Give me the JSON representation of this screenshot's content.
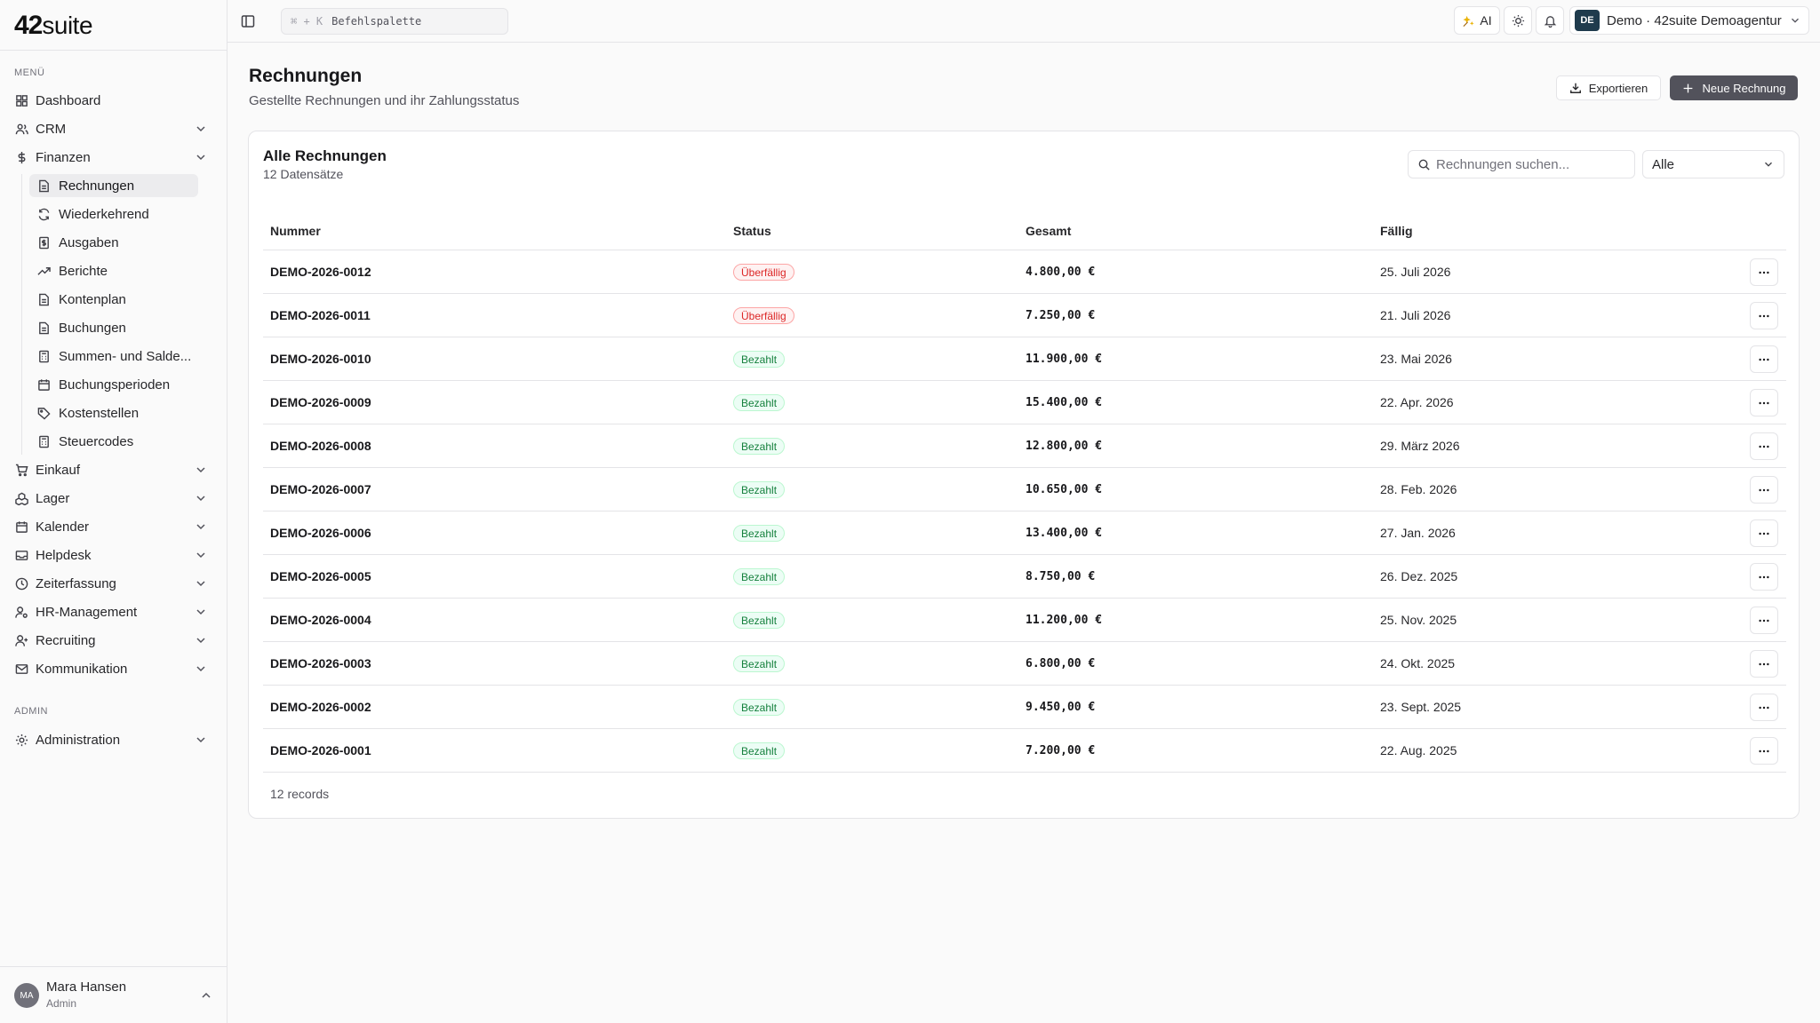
{
  "brand": {
    "logo_num": "42",
    "logo_suite": "suite"
  },
  "sidebar": {
    "menu_label": "MENÜ",
    "admin_label": "ADMIN",
    "items": [
      {
        "label": "Dashboard",
        "icon": "grid-icon"
      },
      {
        "label": "CRM",
        "icon": "users-icon"
      },
      {
        "label": "Finanzen",
        "icon": "dollar-icon"
      },
      {
        "label": "Einkauf",
        "icon": "cart-icon"
      },
      {
        "label": "Lager",
        "icon": "boxes-icon"
      },
      {
        "label": "Kalender",
        "icon": "calendar-icon"
      },
      {
        "label": "Helpdesk",
        "icon": "inbox-icon"
      },
      {
        "label": "Zeiterfassung",
        "icon": "clock-icon"
      },
      {
        "label": "HR-Management",
        "icon": "user-cog-icon"
      },
      {
        "label": "Recruiting",
        "icon": "user-plus-icon"
      },
      {
        "label": "Kommunikation",
        "icon": "mail-icon"
      }
    ],
    "finance_sub": [
      {
        "label": "Rechnungen",
        "icon": "file-text-icon"
      },
      {
        "label": "Wiederkehrend",
        "icon": "refresh-icon"
      },
      {
        "label": "Ausgaben",
        "icon": "receipt-icon"
      },
      {
        "label": "Berichte",
        "icon": "trending-up-icon"
      },
      {
        "label": "Kontenplan",
        "icon": "file-icon"
      },
      {
        "label": "Buchungen",
        "icon": "file-icon"
      },
      {
        "label": "Summen- und Salde...",
        "icon": "calculator-icon"
      },
      {
        "label": "Buchungsperioden",
        "icon": "calendar-icon"
      },
      {
        "label": "Kostenstellen",
        "icon": "tag-icon"
      },
      {
        "label": "Steuercodes",
        "icon": "calculator-icon"
      }
    ],
    "admin_item": {
      "label": "Administration",
      "icon": "settings-icon"
    },
    "user": {
      "initials": "MA",
      "name": "Mara Hansen",
      "role": "Admin"
    }
  },
  "topbar": {
    "cmd_kbd": "⌘ + K",
    "cmd_label": "Befehlspalette",
    "ai_label": "AI",
    "org_badge": "DE",
    "org_label": "Demo · 42suite Demoagentur"
  },
  "page": {
    "title": "Rechnungen",
    "subtitle": "Gestellte Rechnungen und ihr Zahlungsstatus",
    "export_label": "Exportieren",
    "new_label": "Neue Rechnung"
  },
  "card": {
    "title": "Alle Rechnungen",
    "subtitle": "12 Datensätze",
    "search_placeholder": "Rechnungen suchen...",
    "filter_value": "Alle",
    "footer": "12 records"
  },
  "table": {
    "headers": {
      "number": "Nummer",
      "status": "Status",
      "total": "Gesamt",
      "due": "Fällig"
    },
    "rows": [
      {
        "number": "DEMO-2026-0012",
        "status": "Überfällig",
        "status_type": "overdue",
        "total": "4.800,00 €",
        "due": "25. Juli 2026"
      },
      {
        "number": "DEMO-2026-0011",
        "status": "Überfällig",
        "status_type": "overdue",
        "total": "7.250,00 €",
        "due": "21. Juli 2026"
      },
      {
        "number": "DEMO-2026-0010",
        "status": "Bezahlt",
        "status_type": "paid",
        "total": "11.900,00 €",
        "due": "23. Mai 2026"
      },
      {
        "number": "DEMO-2026-0009",
        "status": "Bezahlt",
        "status_type": "paid",
        "total": "15.400,00 €",
        "due": "22. Apr. 2026"
      },
      {
        "number": "DEMO-2026-0008",
        "status": "Bezahlt",
        "status_type": "paid",
        "total": "12.800,00 €",
        "due": "29. März 2026"
      },
      {
        "number": "DEMO-2026-0007",
        "status": "Bezahlt",
        "status_type": "paid",
        "total": "10.650,00 €",
        "due": "28. Feb. 2026"
      },
      {
        "number": "DEMO-2026-0006",
        "status": "Bezahlt",
        "status_type": "paid",
        "total": "13.400,00 €",
        "due": "27. Jan. 2026"
      },
      {
        "number": "DEMO-2026-0005",
        "status": "Bezahlt",
        "status_type": "paid",
        "total": "8.750,00 €",
        "due": "26. Dez. 2025"
      },
      {
        "number": "DEMO-2026-0004",
        "status": "Bezahlt",
        "status_type": "paid",
        "total": "11.200,00 €",
        "due": "25. Nov. 2025"
      },
      {
        "number": "DEMO-2026-0003",
        "status": "Bezahlt",
        "status_type": "paid",
        "total": "6.800,00 €",
        "due": "24. Okt. 2025"
      },
      {
        "number": "DEMO-2026-0002",
        "status": "Bezahlt",
        "status_type": "paid",
        "total": "9.450,00 €",
        "due": "23. Sept. 2025"
      },
      {
        "number": "DEMO-2026-0001",
        "status": "Bezahlt",
        "status_type": "paid",
        "total": "7.200,00 €",
        "due": "22. Aug. 2025"
      }
    ]
  },
  "colors": {
    "primary_button": "#52525b",
    "overdue": "#dc2626",
    "paid": "#15803d",
    "org_badge": "#1f3b4d"
  }
}
